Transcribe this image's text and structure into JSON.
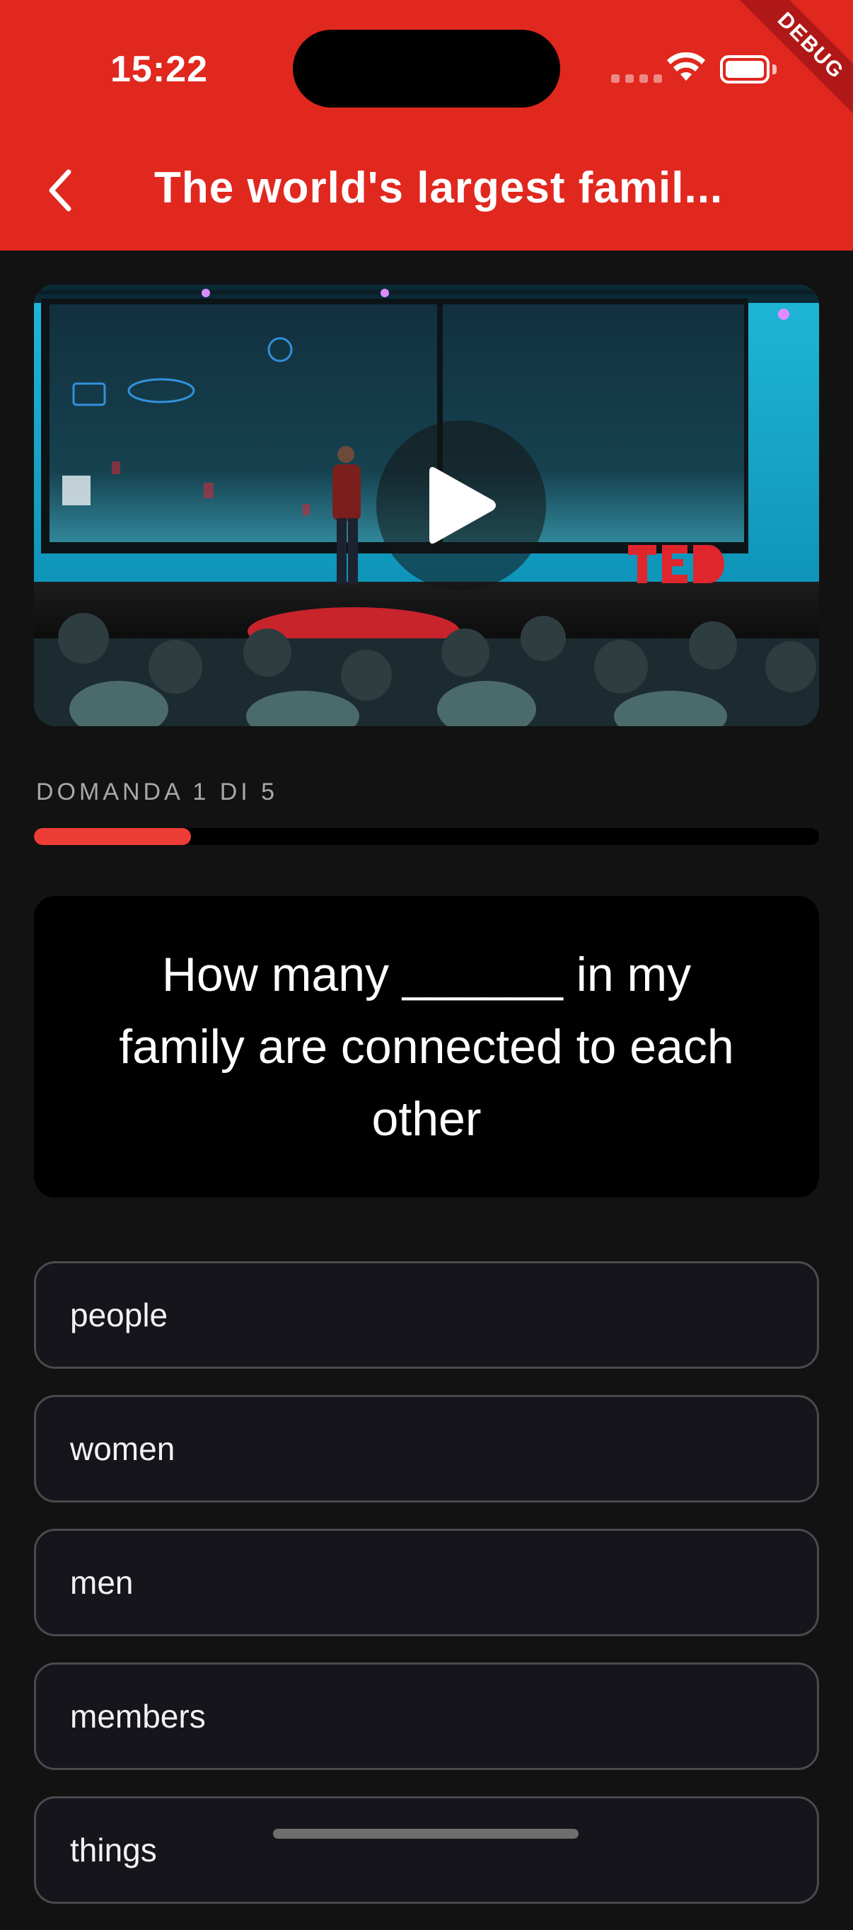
{
  "status_bar": {
    "time": "15:22",
    "debug_label": "DEBUG"
  },
  "header": {
    "title": "The world's largest famil...",
    "back_icon": "chevron-left-icon",
    "background_color": "#e0281f"
  },
  "video": {
    "play_icon": "play-icon",
    "stage_logo": "TED"
  },
  "progress": {
    "label": "DOMANDA 1 DI 5",
    "current": 1,
    "total": 5,
    "fraction": 0.2,
    "accent_color": "#ee3d36"
  },
  "question": {
    "text": "How many ______ in my family are connected to each other"
  },
  "answers": [
    {
      "label": "people"
    },
    {
      "label": "women"
    },
    {
      "label": "men"
    },
    {
      "label": "members"
    },
    {
      "label": "things"
    }
  ]
}
